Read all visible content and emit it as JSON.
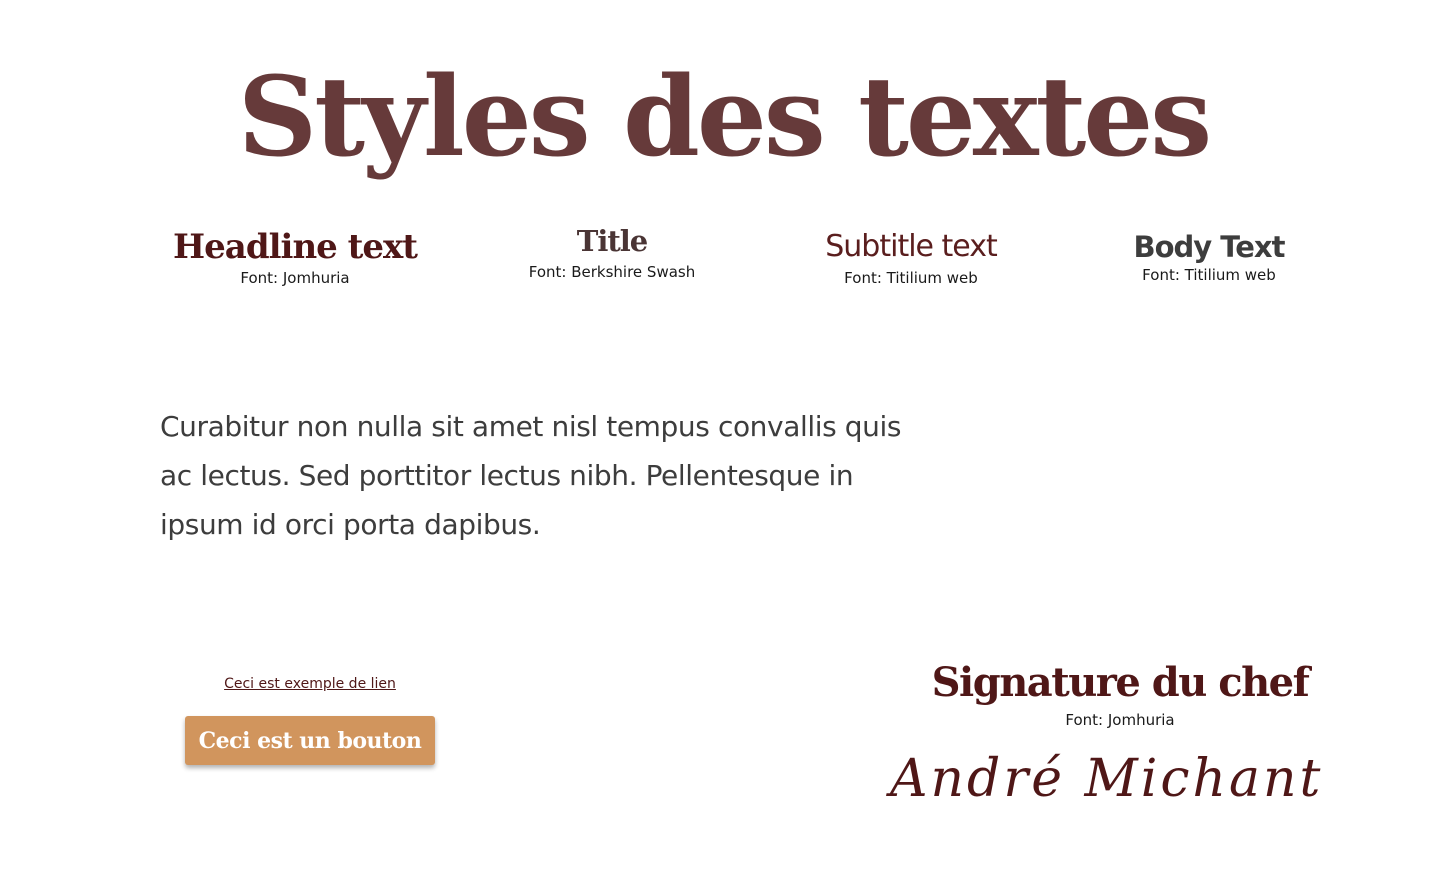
{
  "page": {
    "title": "Styles des textes"
  },
  "styles": [
    {
      "name": "Headline text",
      "font": "Font: Jomhuria"
    },
    {
      "name": "Title",
      "font": "Font: Berkshire Swash"
    },
    {
      "name": "Subtitle text",
      "font": "Font: Titilium web"
    },
    {
      "name": "Body Text",
      "font": "Font: Titilium web"
    }
  ],
  "body_sample": "Curabitur non nulla sit amet nisl tempus convallis quis ac lectus. Sed porttitor lectus nibh. Pellentesque in ipsum id orci porta dapibus.",
  "link_sample": "Ceci est exemple de lien",
  "button_sample": "Ceci est un bouton",
  "signature": {
    "title": "Signature du chef",
    "font": "Font: Jomhuria",
    "name": "André Michant"
  },
  "colors": {
    "heading_brown": "#663a3a",
    "dark_maroon": "#4f1717",
    "body_gray": "#3d3d3d",
    "button_tan": "#d1955d"
  }
}
